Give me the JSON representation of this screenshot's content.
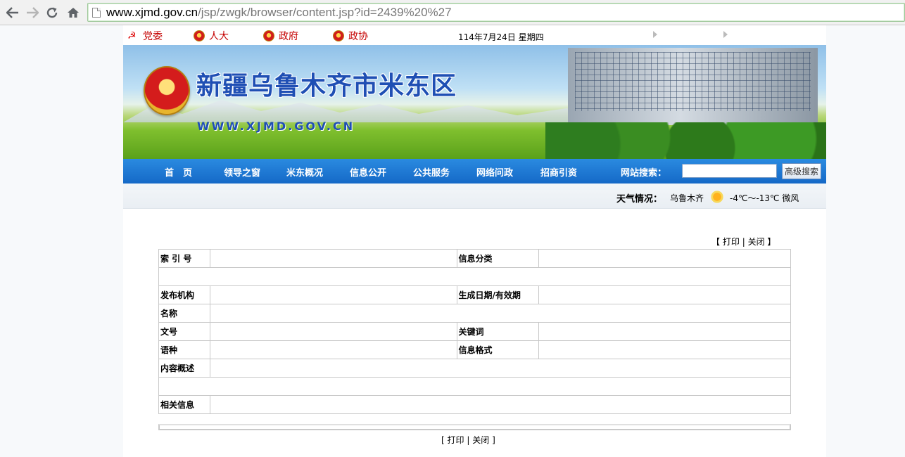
{
  "browser": {
    "url_host": "www.xjmd.gov.cn",
    "url_path": "/jsp/zwgk/browser/content.jsp?id=2439%20%27"
  },
  "top_links": {
    "party": "党委",
    "congress": "人大",
    "government": "政府",
    "cppcc": "政协"
  },
  "date": "114年7月24日  星期四",
  "banner": {
    "title": "新疆乌鲁木齐市米东区",
    "url": "WWW.XJMD.GOV.CN"
  },
  "nav": {
    "items": [
      "首　页",
      "领导之窗",
      "米东概况",
      "信息公开",
      "公共服务",
      "网络问政",
      "招商引资"
    ],
    "search_label": "网站搜索：",
    "search_value": "",
    "search_button": "高级搜索"
  },
  "weather": {
    "label": "天气情况：",
    "city": "乌鲁木齐",
    "temp": "-4℃～-13℃  微风"
  },
  "print_close_top": {
    "open": "【",
    "print": "打印",
    "sep": "|",
    "close": "关闭",
    "end": "】"
  },
  "table": {
    "index_label": "索 引 号",
    "category_label": "信息分类",
    "publisher_label": "发布机构",
    "date_label": "生成日期/有效期",
    "name_label": "名称",
    "doc_no_label": "文号",
    "keywords_label": "关键词",
    "language_label": "语种",
    "format_label": "信息格式",
    "summary_label": "内容概述",
    "related_label": "相关信息"
  },
  "print_close_bottom": {
    "open": "[",
    "print": "打印",
    "sep": "|",
    "close": "关闭",
    "end": "]"
  }
}
